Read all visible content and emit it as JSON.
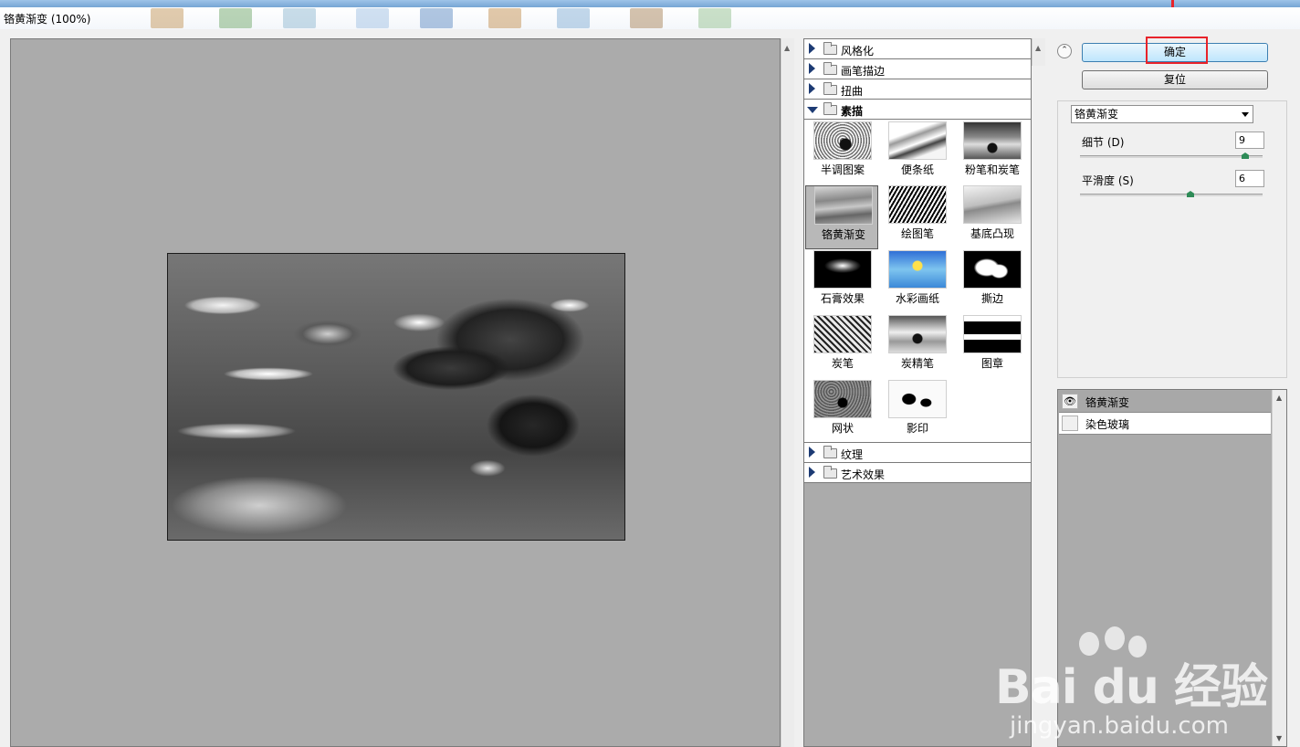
{
  "window": {
    "title": "铬黄渐变 (100%)"
  },
  "gallery": {
    "categories_top": [
      {
        "label": "风格化",
        "open": false
      },
      {
        "label": "画笔描边",
        "open": false
      },
      {
        "label": "扭曲",
        "open": false
      },
      {
        "label": "素描",
        "open": true
      }
    ],
    "thumbnails": [
      {
        "label": "半调图案"
      },
      {
        "label": "便条纸"
      },
      {
        "label": "粉笔和炭笔"
      },
      {
        "label": "铬黄渐变",
        "selected": true
      },
      {
        "label": "绘图笔"
      },
      {
        "label": "基底凸现"
      },
      {
        "label": "石膏效果"
      },
      {
        "label": "水彩画纸"
      },
      {
        "label": "撕边"
      },
      {
        "label": "炭笔"
      },
      {
        "label": "炭精笔"
      },
      {
        "label": "图章"
      },
      {
        "label": "网状"
      },
      {
        "label": "影印"
      }
    ],
    "categories_bottom": [
      {
        "label": "纹理",
        "open": false
      },
      {
        "label": "艺术效果",
        "open": false
      }
    ]
  },
  "settings": {
    "ok_label": "确定",
    "reset_label": "复位",
    "filter_selected": "铬黄渐变",
    "params": [
      {
        "label": "细节 (D)",
        "value": "9",
        "fraction": 0.9
      },
      {
        "label": "平滑度 (S)",
        "value": "6",
        "fraction": 0.6
      }
    ]
  },
  "layers": [
    {
      "name": "铬黄渐变",
      "visible": true,
      "active": true
    },
    {
      "name": "染色玻璃",
      "visible": false,
      "active": false
    }
  ],
  "watermark": {
    "brand": "Bai du 经验",
    "url": "jingyan.baidu.com"
  },
  "colors": {
    "highlight": "#e8232a",
    "accent": "#1d3b74"
  }
}
